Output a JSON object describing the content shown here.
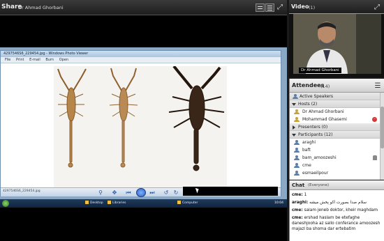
{
  "share": {
    "title": "Share",
    "presenter": "Dr Ahmad Ghorbani"
  },
  "photo_viewer": {
    "title": "4297546S6_229454.jpg - Windows Photo Viewer",
    "menu": [
      "File",
      "Print",
      "E-mail",
      "Burn",
      "Open"
    ],
    "filename": "4297546S6_229454.jpg"
  },
  "taskbar": {
    "items": [
      "Desktop",
      "Libraries",
      "Computer"
    ],
    "clock": "10:04"
  },
  "video": {
    "title": "Video",
    "count": "(1)",
    "name_tag": "Dr Ahmad Ghorbani"
  },
  "attendees": {
    "title": "Attendees",
    "count": "(14)",
    "groups": [
      {
        "label": "Active Speakers"
      },
      {
        "label": "Hosts (2)"
      },
      {
        "label": "Presenters (0)"
      },
      {
        "label": "Participants (12)"
      }
    ],
    "hosts": [
      "Dr Ahmad Ghorbani",
      "Mohammad Ghasemi"
    ],
    "participants": [
      "araghi",
      "baft",
      "bam_amoozeshi",
      "cme",
      "esmaeilpour"
    ]
  },
  "chat": {
    "title": "Chat",
    "audience": "(Everyone)",
    "messages": [
      {
        "sender": "cme:",
        "text": "1"
      },
      {
        "sender": "araghi:",
        "text": "سلام صدا بصورت اکو پخش میشه"
      },
      {
        "sender": "cme:",
        "text": "salam jeneb doktor, kheir maghdam"
      },
      {
        "sender": "cme:",
        "text": "ershad haslam be etefaghe daneshjooha az sallo conferance amoozesh majazi ba shoma dar ertebatim"
      }
    ]
  }
}
